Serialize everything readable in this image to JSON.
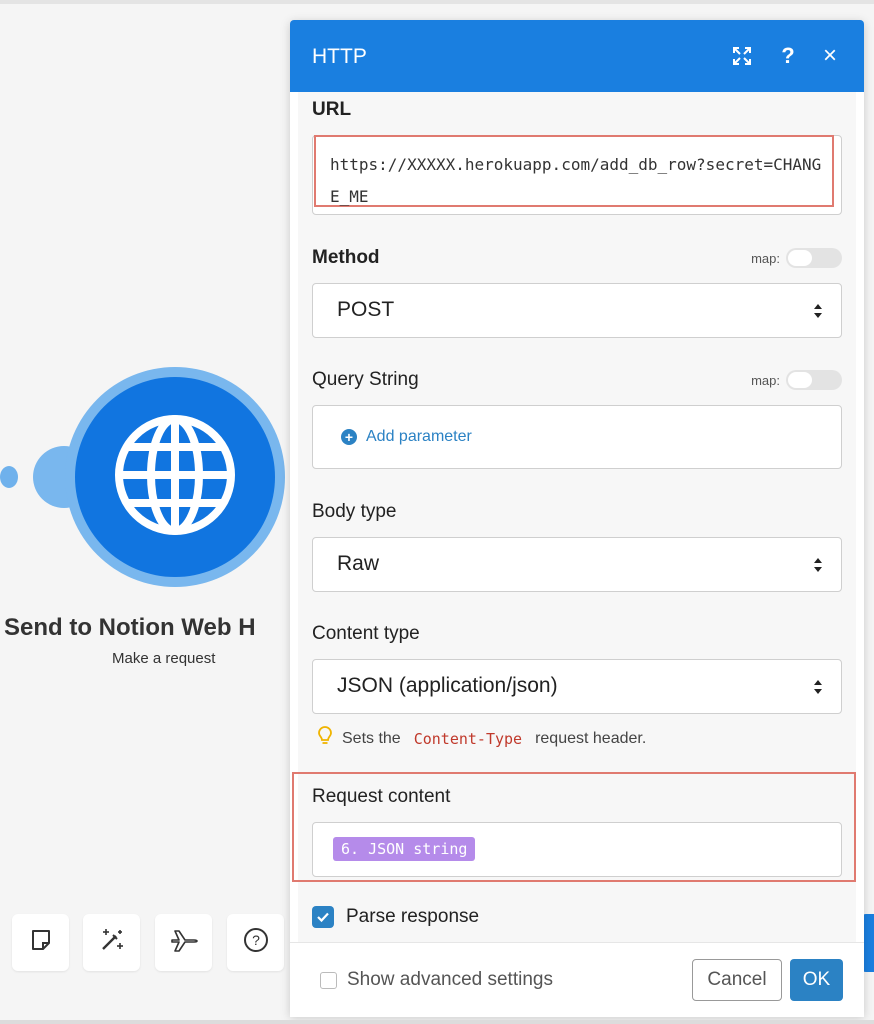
{
  "colors": {
    "header": "#1a7fe0",
    "module_core": "#1175e0",
    "module_ring": "#79b7ee",
    "accent": "#2b82c4",
    "highlight": "#e07a70",
    "pill": "#b58bea"
  },
  "canvas": {
    "module": {
      "icon": "globe-icon",
      "title": "Send to Notion Web H",
      "subtitle": "Make a request"
    },
    "toolbar": [
      {
        "icon": "note-icon"
      },
      {
        "icon": "magic-wand-icon"
      },
      {
        "icon": "airplane-icon"
      },
      {
        "icon": "help-circle-icon"
      }
    ]
  },
  "dialog": {
    "title": "HTTP",
    "header_icons": [
      "expand-icon",
      "help-icon",
      "close-icon"
    ],
    "help_glyph": "?",
    "close_glyph": "×",
    "url": {
      "label": "URL",
      "value": "https://XXXXX.herokuapp.com/add_db_row?secret=CHANGE_ME"
    },
    "method": {
      "label": "Method",
      "map_label": "map:",
      "value": "POST"
    },
    "query_string": {
      "label": "Query String",
      "map_label": "map:",
      "add_label": "Add parameter"
    },
    "body_type": {
      "label": "Body type",
      "value": "Raw"
    },
    "content_type": {
      "label": "Content type",
      "value": "JSON (application/json)",
      "hint_prefix": "Sets the",
      "hint_code": "Content-Type",
      "hint_suffix": "request header."
    },
    "request_content": {
      "label": "Request content",
      "pill": "6. JSON string"
    },
    "parse_response": {
      "label": "Parse response",
      "checked": true
    },
    "footer": {
      "advanced_label": "Show advanced settings",
      "cancel": "Cancel",
      "ok": "OK"
    }
  }
}
